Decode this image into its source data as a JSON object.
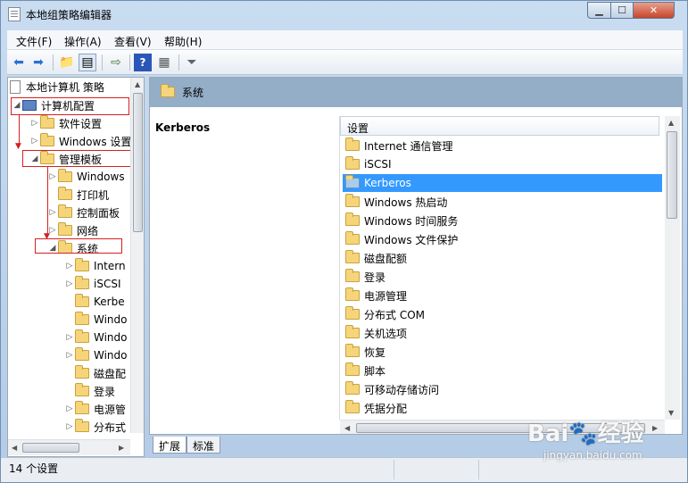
{
  "window": {
    "title": "本地组策略编辑器",
    "min_glyph": "▁",
    "max_glyph": "☐",
    "close_glyph": "✕"
  },
  "menu": [
    "文件(F)",
    "操作(A)",
    "查看(V)",
    "帮助(H)"
  ],
  "toolbar": {
    "icons": [
      "back-arrow-icon",
      "forward-arrow-icon",
      "up-folder-icon",
      "show-hide-tree-icon",
      "export-list-icon",
      "help-icon",
      "properties-icon",
      "filter-icon"
    ]
  },
  "tree": {
    "root": "本地计算机 策略",
    "computer_config": "计算机配置",
    "software_settings": "软件设置",
    "windows_settings": "Windows 设置",
    "admin_templates": "管理模板",
    "admin_children": [
      "Windows",
      "打印机",
      "控制面板",
      "网络"
    ],
    "system": "系统",
    "system_children": [
      "Intern",
      "iSCSI",
      "Kerbe",
      "Windo",
      "Windo",
      "Windo",
      "磁盘配",
      "登录",
      "电源管",
      "分布式"
    ]
  },
  "right": {
    "header_title": "系统",
    "desc_title": "Kerberos",
    "column_header": "设置",
    "items": [
      "Internet 通信管理",
      "iSCSI",
      "Kerberos",
      "Windows 热启动",
      "Windows 时间服务",
      "Windows 文件保护",
      "磁盘配额",
      "登录",
      "电源管理",
      "分布式 COM",
      "关机选项",
      "恢复",
      "脚本",
      "可移动存储访问",
      "凭据分配"
    ],
    "selected_index": 2
  },
  "tabs": [
    "扩展",
    "标准"
  ],
  "status": {
    "text": "14 个设置"
  },
  "watermark": {
    "brand": "Bai🐾经验",
    "url": "jingyan.baidu.com"
  },
  "colors": {
    "selection": "#3399ff",
    "annotation": "#d62020",
    "header_band": "#94aec8"
  }
}
